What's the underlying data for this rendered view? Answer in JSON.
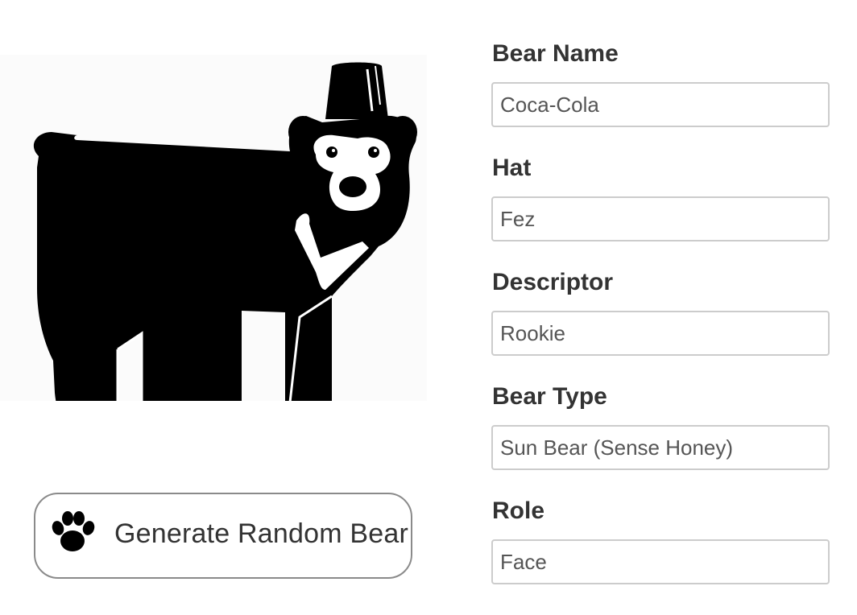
{
  "bear_image": {
    "icon": "bear-with-fez-icon",
    "alt": "Bear wearing a fez"
  },
  "generate_button": {
    "label": "Generate Random Bear",
    "icon": "paw-icon"
  },
  "form": {
    "fields": [
      {
        "label": "Bear Name",
        "value": "Coca-Cola"
      },
      {
        "label": "Hat",
        "value": "Fez"
      },
      {
        "label": "Descriptor",
        "value": "Rookie"
      },
      {
        "label": "Bear Type",
        "value": "Sun Bear (Sense Honey)"
      },
      {
        "label": "Role",
        "value": "Face"
      }
    ]
  },
  "colors": {
    "text": "#333333",
    "input_border": "#cccccc",
    "button_border": "#8a8a8a",
    "bear": "#000000"
  }
}
